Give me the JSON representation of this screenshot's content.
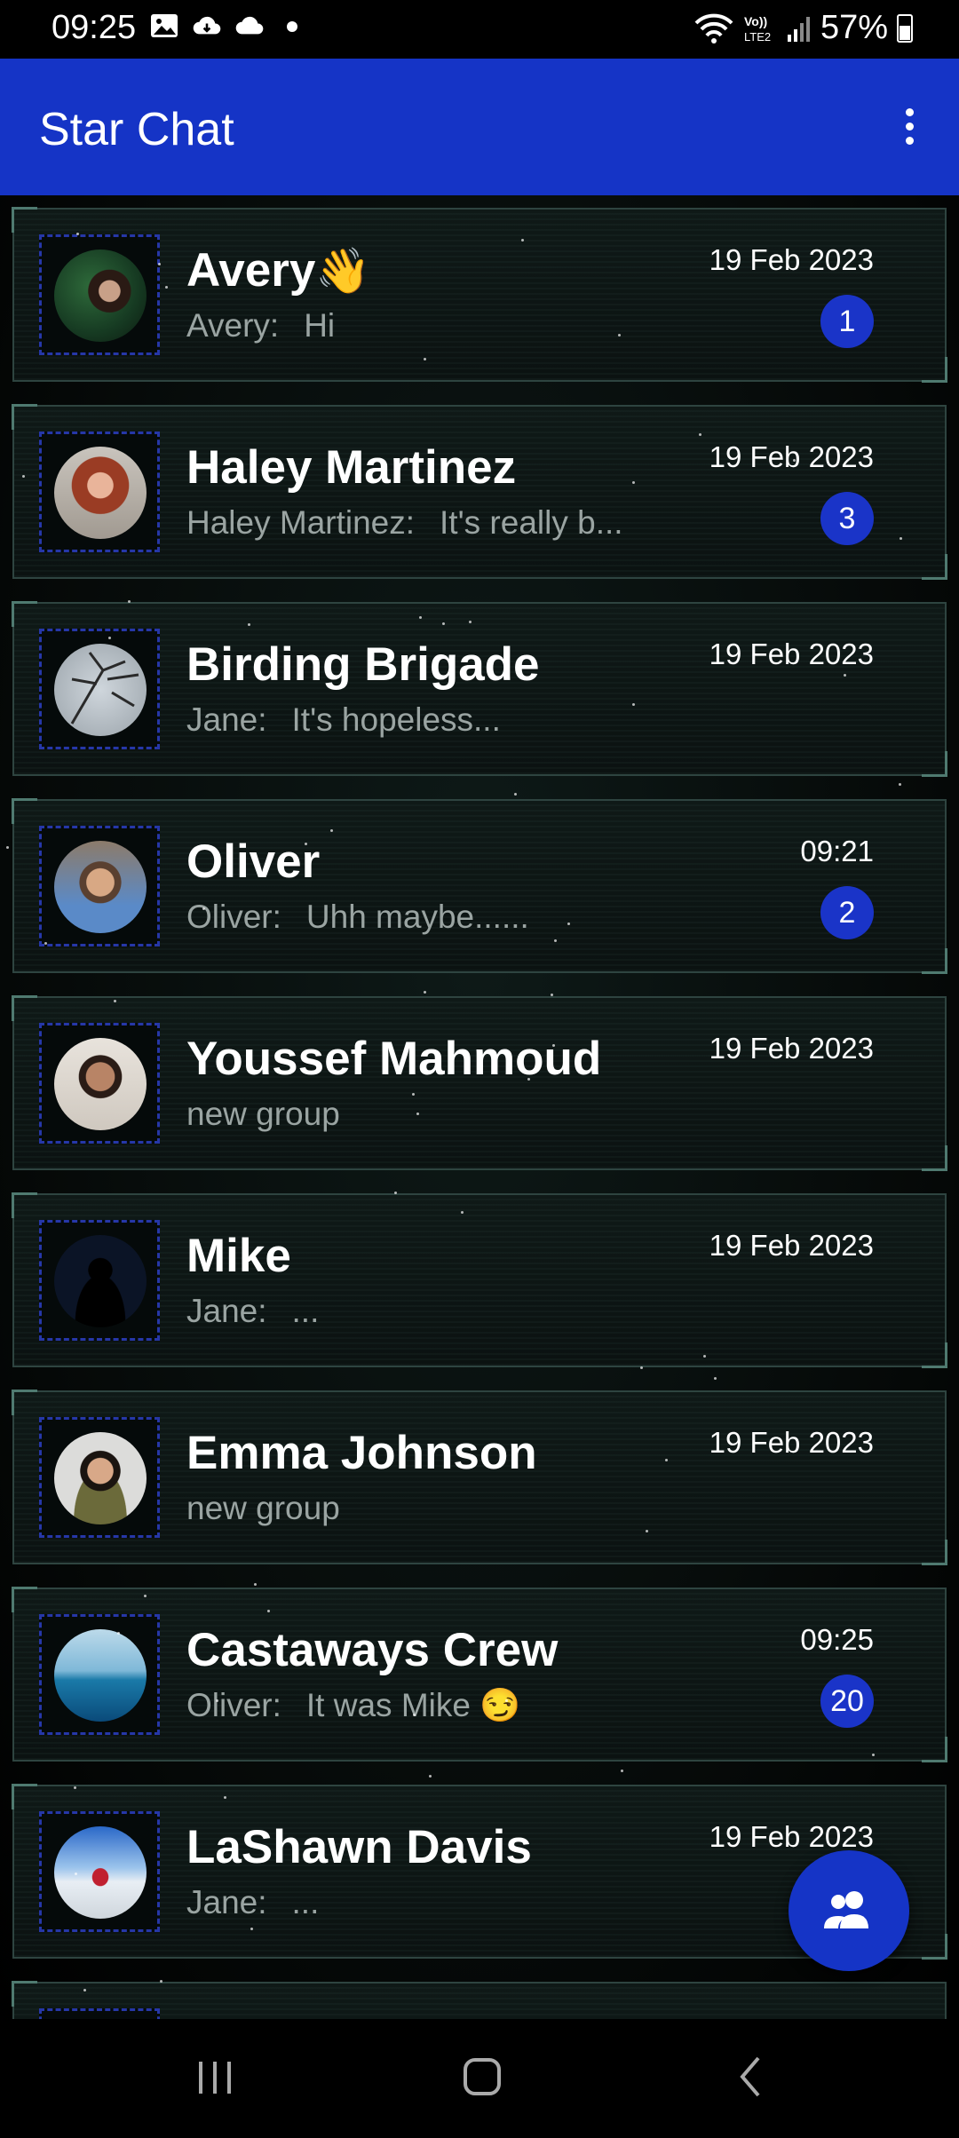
{
  "status_bar": {
    "time": "09:25",
    "battery": "57%",
    "battery_level": 0.57,
    "icons": [
      "image-icon",
      "cloud-sync-icon",
      "cloud-icon",
      "dot-icon",
      "wifi-icon",
      "volte-icon",
      "signal-icon",
      "battery-icon"
    ]
  },
  "app_bar": {
    "title": "Star Chat",
    "menu_icon": "more-vert-icon"
  },
  "colors": {
    "accent": "#1534c6",
    "badge": "#1a34c8",
    "preview_text": "#9aa4a2"
  },
  "chats": [
    {
      "name": "Avery",
      "emoji": "👋",
      "sender": "Avery:",
      "message": "Hi",
      "time": "19 Feb 2023",
      "unread": "1",
      "avatar": "avery-avatar"
    },
    {
      "name": "Haley Martinez",
      "sender": "Haley Martinez:",
      "message": "It's really b...",
      "time": "19 Feb 2023",
      "unread": "3",
      "avatar": "haley-avatar"
    },
    {
      "name": "Birding Brigade",
      "sender": "Jane:",
      "message": "It's hopeless...",
      "time": "19 Feb 2023",
      "unread": "",
      "avatar": "birding-avatar"
    },
    {
      "name": "Oliver",
      "sender": "Oliver:",
      "message": "Uhh maybe......",
      "time": "09:21",
      "unread": "2",
      "avatar": "oliver-avatar"
    },
    {
      "name": "Youssef Mahmoud",
      "sender": "",
      "message": "new group",
      "time": "19 Feb 2023",
      "unread": "",
      "avatar": "youssef-avatar"
    },
    {
      "name": "Mike",
      "sender": "Jane:",
      "message": "...",
      "time": "19 Feb 2023",
      "unread": "",
      "avatar": "default-person-avatar"
    },
    {
      "name": "Emma Johnson",
      "sender": "",
      "message": "new group",
      "time": "19 Feb 2023",
      "unread": "",
      "avatar": "emma-avatar"
    },
    {
      "name": "Castaways Crew",
      "sender": "Oliver:",
      "message": "It was Mike 😏",
      "time": "09:25",
      "unread": "20",
      "avatar": "castaways-avatar"
    },
    {
      "name": "LaShawn Davis",
      "sender": "Jane:",
      "message": "...",
      "time": "19 Feb 2023",
      "unread": "",
      "avatar": "lashawn-avatar"
    }
  ],
  "fab": {
    "icon": "group-icon"
  },
  "nav_bar": {
    "icons": [
      "recent-apps-icon",
      "home-icon",
      "back-icon"
    ]
  }
}
